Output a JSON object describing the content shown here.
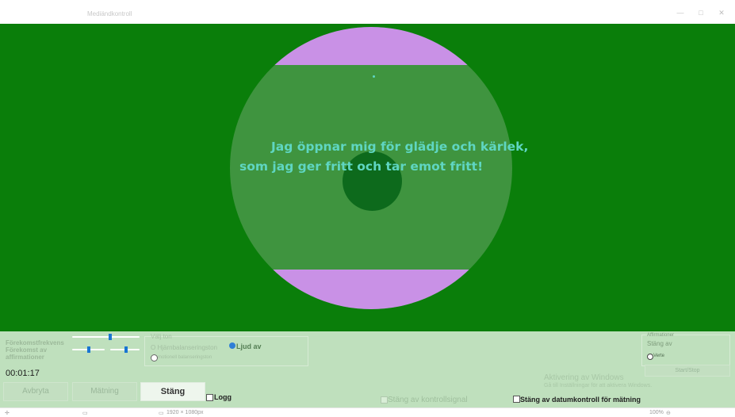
{
  "window": {
    "title": "Mediändkontroll",
    "minimize": "—",
    "maximize": "□",
    "close": "✕"
  },
  "affirmation": {
    "line1": "Jag öppnar mig för glädje och kärlek,",
    "line2": "som jag ger fritt och tar emot fritt!",
    "text_color": "#5fd6c2"
  },
  "colors": {
    "stage": "#0a7e0a",
    "disc": "#3f943f",
    "band": "#c991e6",
    "panel": "#bfe0bd"
  },
  "controls": {
    "frequency_label": "Förekomstfrekvens",
    "occurrence_label": "Förekomst av affirmationer",
    "timer": "00:01:17",
    "tone_group_label": "Välj ton",
    "tone_option_1": "O Hjärnbalanseringston",
    "tone_option_2": "motionell balanseringston",
    "sound_off": "Ljud av",
    "affirmations_group": "Affirmationer",
    "affirmations_off": "Stäng av",
    "vertical_option": "Verte",
    "start_stop": "Start/Stop",
    "activation_line1": "Aktivering av Windows",
    "activation_line2": "Gå till Inställningar för att aktivera Windows."
  },
  "buttons": {
    "abort": "Avbryta",
    "measure": "Mätning",
    "close": "Stäng"
  },
  "checkboxes": {
    "log": "Logg",
    "control_signal": "Stäng av kontrollsignal",
    "date_control": "Stäng av datumkontroll för mätning"
  },
  "statusbar": {
    "resolution": "1920 × 1080px",
    "zoom": "100%"
  }
}
